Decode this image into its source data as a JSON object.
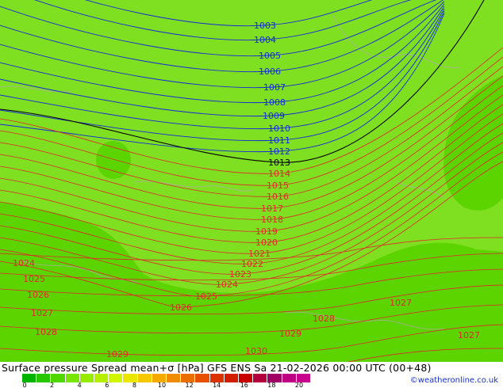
{
  "footer": {
    "title": "Surface pressure Spread mean+σ [hPa] GFS ENS  Sa 21-02-2026 00:00 UTC (00+48)",
    "credit": "©weatheronline.co.uk",
    "scale_colors": [
      "#00b400",
      "#28c800",
      "#50d700",
      "#78e600",
      "#96eb00",
      "#b4f000",
      "#d2f500",
      "#ebe600",
      "#f5c800",
      "#f5aa00",
      "#f08c00",
      "#eb6e00",
      "#e65000",
      "#dc3200",
      "#d21e00",
      "#c80000",
      "#b4003c",
      "#a00064",
      "#be0082",
      "#c8008c"
    ],
    "scale_ticks": [
      "0",
      "2",
      "4",
      "6",
      "8",
      "10",
      "12",
      "14",
      "16",
      "18",
      "20"
    ]
  },
  "map": {
    "blue_isobars": [
      {
        "label": "1003"
      },
      {
        "label": "1004"
      },
      {
        "label": "1005"
      },
      {
        "label": "1006"
      },
      {
        "label": "1007"
      },
      {
        "label": "1008"
      },
      {
        "label": "1009"
      },
      {
        "label": "1010"
      },
      {
        "label": "1011"
      },
      {
        "label": "1012"
      }
    ],
    "black_isobar": {
      "label": "1013"
    },
    "red_isobars": [
      {
        "label": "1014"
      },
      {
        "label": "1015"
      },
      {
        "label": "1016"
      },
      {
        "label": "1017"
      },
      {
        "label": "1018"
      },
      {
        "label": "1019"
      },
      {
        "label": "1020"
      },
      {
        "label": "1021"
      },
      {
        "label": "1022"
      },
      {
        "label": "1023"
      },
      {
        "label": "1024"
      },
      {
        "label": "1025"
      },
      {
        "label": "1026"
      }
    ],
    "lower_labels": [
      {
        "label": "1024"
      },
      {
        "label": "1025"
      },
      {
        "label": "1026"
      },
      {
        "label": "1027"
      },
      {
        "label": "1028"
      },
      {
        "label": "1029"
      },
      {
        "label": "1030"
      },
      {
        "label": "1028"
      },
      {
        "label": "1029"
      },
      {
        "label": "1027"
      },
      {
        "label": "1027"
      }
    ],
    "colors": {
      "light_green": "#7ee020",
      "dark_green": "#5cd400",
      "blue_line": "#1428dc",
      "red_line": "#e02828",
      "black_line": "#000000",
      "border": "#b4a6b4"
    }
  }
}
